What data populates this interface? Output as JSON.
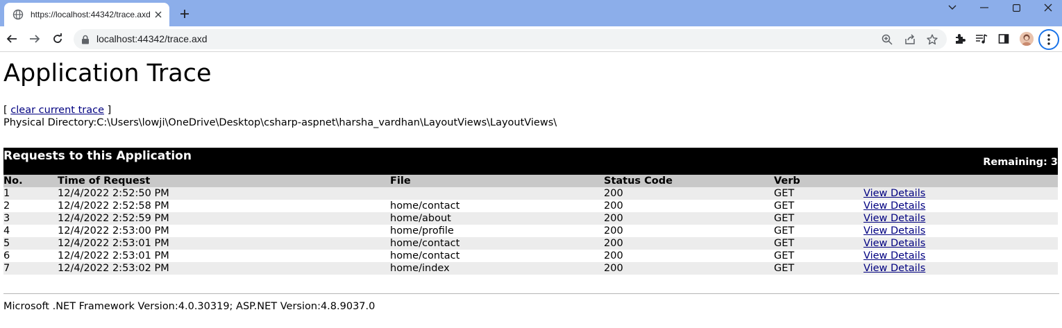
{
  "browser": {
    "tab_title": "https://localhost:44342/trace.axd",
    "url": "localhost:44342/trace.axd"
  },
  "page": {
    "title": "Application Trace",
    "clear_prefix": "[",
    "clear_link": "clear current trace",
    "clear_suffix": "]",
    "physical_directory_label": "Physical Directory:",
    "physical_directory": "C:\\Users\\lowji\\OneDrive\\Desktop\\csharp-aspnet\\harsha_vardhan\\LayoutViews\\LayoutViews\\"
  },
  "requests": {
    "title": "Requests to this Application",
    "remaining": "Remaining: 3",
    "columns": [
      "No.",
      "Time of Request",
      "File",
      "Status Code",
      "Verb"
    ],
    "rows": [
      {
        "no": "1",
        "time": "12/4/2022 2:52:50 PM",
        "file": "",
        "status": "200",
        "verb": "GET",
        "link": "View Details"
      },
      {
        "no": "2",
        "time": "12/4/2022 2:52:58 PM",
        "file": "home/contact",
        "status": "200",
        "verb": "GET",
        "link": "View Details"
      },
      {
        "no": "3",
        "time": "12/4/2022 2:52:59 PM",
        "file": "home/about",
        "status": "200",
        "verb": "GET",
        "link": "View Details"
      },
      {
        "no": "4",
        "time": "12/4/2022 2:53:00 PM",
        "file": "home/profile",
        "status": "200",
        "verb": "GET",
        "link": "View Details"
      },
      {
        "no": "5",
        "time": "12/4/2022 2:53:01 PM",
        "file": "home/contact",
        "status": "200",
        "verb": "GET",
        "link": "View Details"
      },
      {
        "no": "6",
        "time": "12/4/2022 2:53:01 PM",
        "file": "home/contact",
        "status": "200",
        "verb": "GET",
        "link": "View Details"
      },
      {
        "no": "7",
        "time": "12/4/2022 2:53:02 PM",
        "file": "home/index",
        "status": "200",
        "verb": "GET",
        "link": "View Details"
      }
    ]
  },
  "footer": {
    "text": "Microsoft .NET Framework Version:4.0.30319; ASP.NET Version:4.8.9037.0"
  },
  "colors": {
    "tabbar": "#8caeea",
    "header_band": "#000000",
    "table_head": "#c8c8c8",
    "row_alt": "#ececec",
    "link": "#000080"
  },
  "icons": [
    "globe-icon",
    "close-icon",
    "plus-icon",
    "chevron-down-icon",
    "minimize-icon",
    "maximize-icon",
    "close-window-icon",
    "back-arrow-icon",
    "forward-arrow-icon",
    "reload-icon",
    "lock-icon",
    "zoom-icon",
    "share-icon",
    "star-icon",
    "puzzle-icon",
    "media-icon",
    "side-panel-icon",
    "kebab-menu-icon"
  ]
}
